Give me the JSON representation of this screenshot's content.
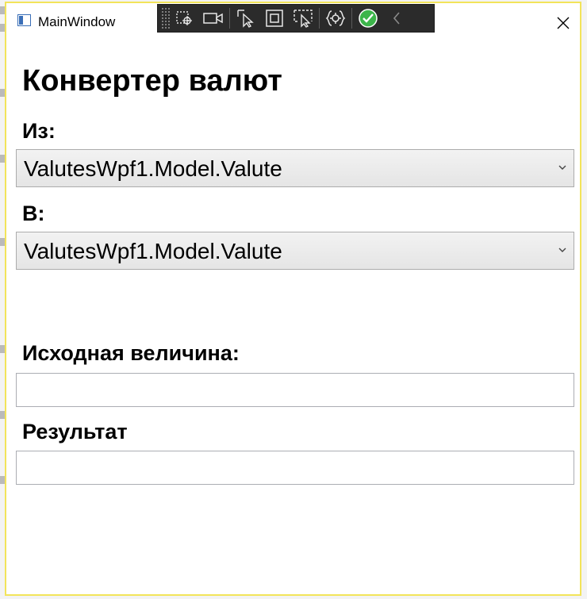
{
  "window": {
    "title": "MainWindow"
  },
  "devtools": {
    "icons": [
      "select-element-icon",
      "record-icon",
      "pointer-select-icon",
      "layout-adorner-icon",
      "track-focus-icon",
      "binding-failures-icon",
      "hot-reload-ok-icon",
      "collapse-icon"
    ]
  },
  "main": {
    "heading": "Конвертер валют",
    "from_label": "Из:",
    "from_value": "ValutesWpf1.Model.Valute",
    "to_label": "В:",
    "to_value": "ValutesWpf1.Model.Valute",
    "amount_label": "Исходная величина:",
    "amount_value": "",
    "result_label": "Результат",
    "result_value": ""
  },
  "colors": {
    "window_border": "#f2e45a",
    "devbar_bg": "#2b2b2b",
    "hot_reload_ok": "#3cb54a"
  }
}
